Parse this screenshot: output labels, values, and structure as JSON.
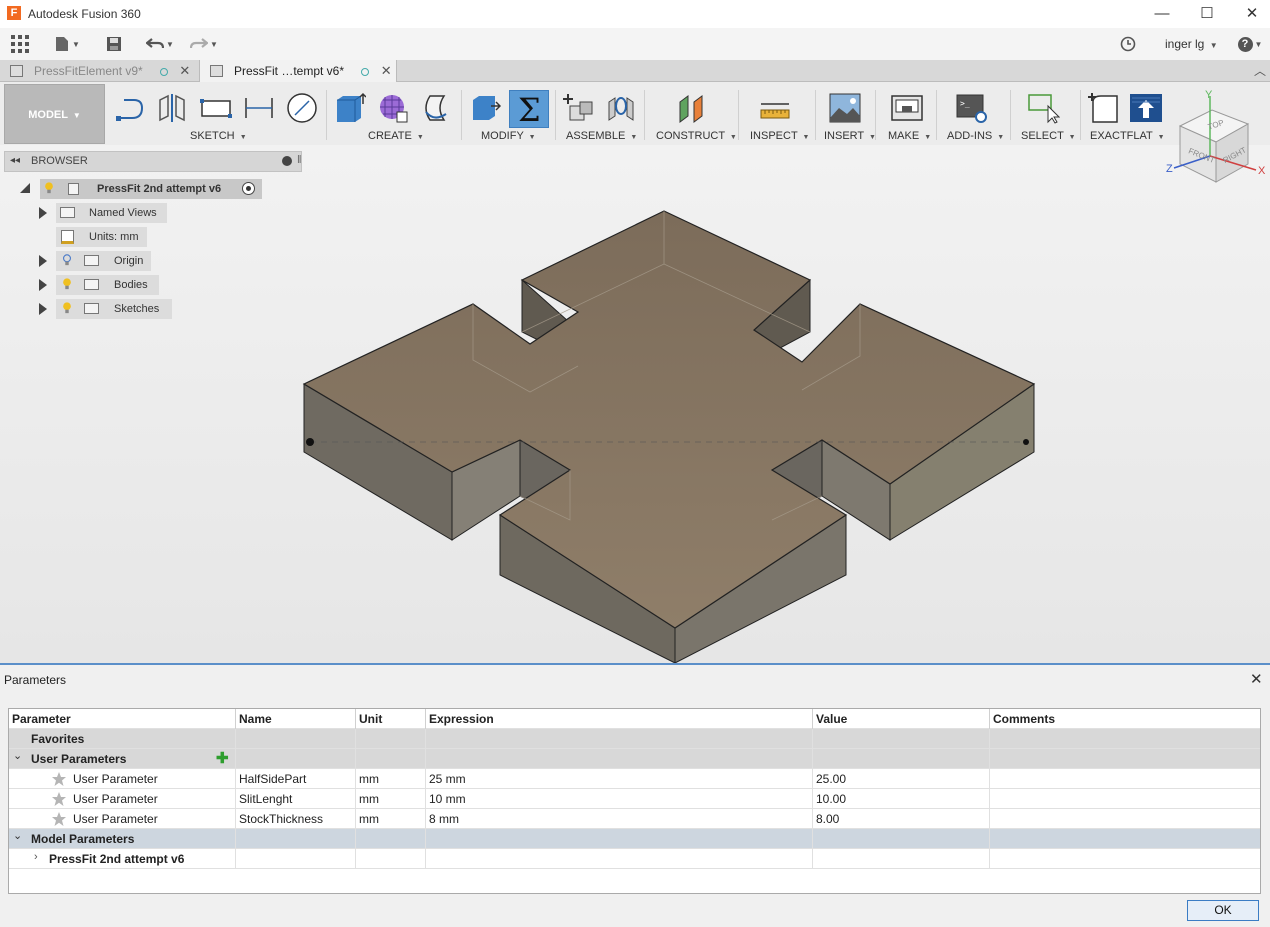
{
  "app": {
    "title": "Autodesk Fusion 360",
    "icon_letter": "F"
  },
  "window_controls": {
    "minimize": "—",
    "maximize": "☐",
    "close": "✕"
  },
  "quick_access": {
    "user": "inger lg",
    "help": "?"
  },
  "tabs": [
    {
      "label": "PressFitElement v9*",
      "active": false,
      "close": "✕"
    },
    {
      "label": "PressFit …tempt v6*",
      "active": true,
      "close": "✕"
    }
  ],
  "toolbar": {
    "workspace": "MODEL",
    "groups": [
      "SKETCH",
      "CREATE",
      "MODIFY",
      "ASSEMBLE",
      "CONSTRUCT",
      "INSPECT",
      "INSERT",
      "MAKE",
      "ADD-INS",
      "SELECT",
      "EXACTFLAT"
    ]
  },
  "viewcube": {
    "top": "TOP",
    "front": "FRONT",
    "right": "RIGHT",
    "x": "X",
    "y": "Y",
    "z": "Z"
  },
  "browser": {
    "header": "BROWSER",
    "root": "PressFit 2nd attempt v6",
    "items": [
      {
        "label": "Named Views"
      },
      {
        "label": "Units: mm"
      },
      {
        "label": "Origin"
      },
      {
        "label": "Bodies"
      },
      {
        "label": "Sketches"
      }
    ]
  },
  "parameters": {
    "title": "Parameters",
    "close": "✕",
    "columns": [
      "Parameter",
      "Name",
      "Unit",
      "Expression",
      "Value",
      "Comments"
    ],
    "favorites_label": "Favorites",
    "user_group_label": "User Parameters",
    "user_rows": [
      {
        "param": "User Parameter",
        "name": "HalfSidePart",
        "unit": "mm",
        "expression": "25 mm",
        "value": "25.00",
        "comments": ""
      },
      {
        "param": "User Parameter",
        "name": "SlitLenght",
        "unit": "mm",
        "expression": "10 mm",
        "value": "10.00",
        "comments": ""
      },
      {
        "param": "User Parameter",
        "name": "StockThickness",
        "unit": "mm",
        "expression": "8 mm",
        "value": "8.00",
        "comments": ""
      }
    ],
    "model_group_label": "Model Parameters",
    "model_child": "PressFit 2nd attempt v6",
    "ok": "OK"
  },
  "colors": {
    "accent": "#5b8fc9",
    "body_fill": "#8a7a66",
    "modify_active": "#5b9bd5"
  }
}
